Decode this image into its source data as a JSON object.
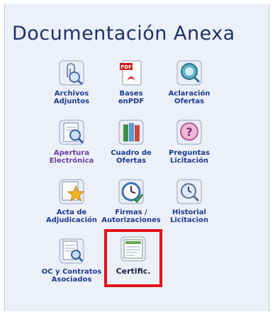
{
  "title": "Documentación Anexa",
  "items": [
    {
      "label": "Archivos\nAdjuntos",
      "icon": "attachment-magnifier-icon"
    },
    {
      "label": "Bases\nenPDF",
      "icon": "pdf-document-icon"
    },
    {
      "label": "Aclaración\nOfertas",
      "icon": "magnifier-help-icon"
    },
    {
      "label": "Apertura\nElectrónica",
      "icon": "document-magnifier-icon"
    },
    {
      "label": "Cuadro de\nOfertas",
      "icon": "books-icon"
    },
    {
      "label": "Preguntas\nLicitación",
      "icon": "question-mark-icon"
    },
    {
      "label": "Acta de\nAdjudicación",
      "icon": "star-document-icon"
    },
    {
      "label": "Firmas /\nAutorizaciones",
      "icon": "clock-check-icon"
    },
    {
      "label": "Historial\nLicitacion",
      "icon": "history-search-icon"
    },
    {
      "label": "OC y Contratos\nAsociados",
      "icon": "contract-magnifier-icon"
    },
    {
      "label": "Certific.",
      "icon": "certificate-document-icon"
    }
  ],
  "colors": {
    "title": "#1e2f6b",
    "label": "#1e3a8f",
    "label_accent": "#6b3fa0",
    "highlight": "#e0121a",
    "panel_bg": "#ecf0f8"
  }
}
